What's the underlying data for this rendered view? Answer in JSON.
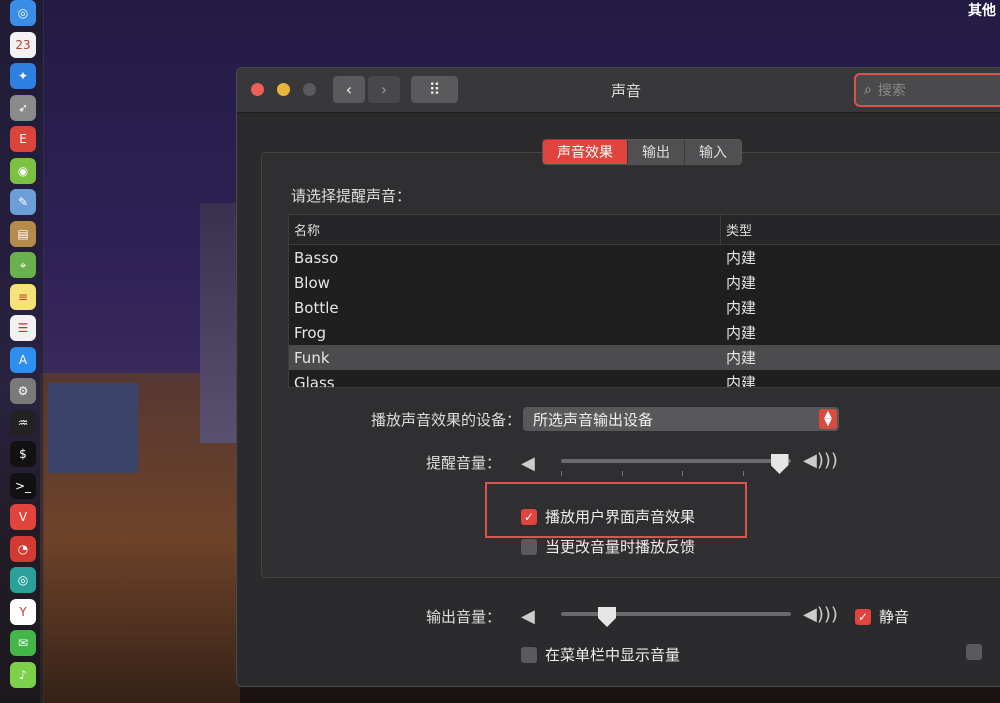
{
  "desktop": {
    "top_right_text": "其他"
  },
  "dock": {
    "items": [
      {
        "icon": "safari-icon",
        "color": "#3a8ee6",
        "glyph": "◎"
      },
      {
        "icon": "calendar-icon",
        "color": "#f2f2f2",
        "glyph": "23"
      },
      {
        "icon": "compass-icon",
        "color": "#2f7fe0",
        "glyph": "✦"
      },
      {
        "icon": "rocket-icon",
        "color": "#8a8a8a",
        "glyph": "➶"
      },
      {
        "icon": "app-red-icon",
        "color": "#d9453b",
        "glyph": "E"
      },
      {
        "icon": "android-icon",
        "color": "#7cc142",
        "glyph": "◉"
      },
      {
        "icon": "preview-icon",
        "color": "#6c9fd8",
        "glyph": "✎"
      },
      {
        "icon": "notebook-icon",
        "color": "#b58b4c",
        "glyph": "▤"
      },
      {
        "icon": "maps-icon",
        "color": "#6ab04c",
        "glyph": "⌖"
      },
      {
        "icon": "notes-icon",
        "color": "#f5e27a",
        "glyph": "≡"
      },
      {
        "icon": "reminders-icon",
        "color": "#f2f2f2",
        "glyph": "☰"
      },
      {
        "icon": "appstore-icon",
        "color": "#2f8ff0",
        "glyph": "A"
      },
      {
        "icon": "system-preferences-icon",
        "color": "#7a7a7a",
        "glyph": "⚙"
      },
      {
        "icon": "activity-monitor-icon",
        "color": "#222",
        "glyph": "♒"
      },
      {
        "icon": "terminal-dollar-icon",
        "color": "#111",
        "glyph": "$"
      },
      {
        "icon": "terminal-icon",
        "color": "#111",
        "glyph": ">_"
      },
      {
        "icon": "vivaldi-icon",
        "color": "#e0443c",
        "glyph": "V"
      },
      {
        "icon": "netease-music-icon",
        "color": "#d33a31",
        "glyph": "◔"
      },
      {
        "icon": "eye-app-icon",
        "color": "#2aa198",
        "glyph": "◎"
      },
      {
        "icon": "yandex-icon",
        "color": "#ffffff",
        "glyph": "Y"
      },
      {
        "icon": "wechat-icon",
        "color": "#44b549",
        "glyph": "✉"
      },
      {
        "icon": "note-app-icon",
        "color": "#7cd04a",
        "glyph": "♪"
      }
    ]
  },
  "window": {
    "title": "声音",
    "search_placeholder": "搜索",
    "back_glyph": "‹",
    "forward_glyph": "›",
    "grid_glyph": "⠿",
    "tabs": [
      "声音效果",
      "输出",
      "输入"
    ],
    "active_tab": 0,
    "prompt": "请选择提醒声音：",
    "list": {
      "headers": [
        "名称",
        "类型"
      ],
      "rows": [
        {
          "name": "Basso",
          "type": "内建"
        },
        {
          "name": "Blow",
          "type": "内建"
        },
        {
          "name": "Bottle",
          "type": "内建"
        },
        {
          "name": "Frog",
          "type": "内建"
        },
        {
          "name": "Funk",
          "type": "内建"
        },
        {
          "name": "Glass",
          "type": "内建"
        }
      ],
      "selected_index": 4
    },
    "device_label": "播放声音效果的设备：",
    "device_value": "所选声音输出设备",
    "alert_volume_label": "提醒音量：",
    "alert_volume_level": 0.95,
    "ui_sound_label": "播放用户界面声音效果",
    "ui_sound_checked": true,
    "feedback_label": "当更改音量时播放反馈",
    "feedback_checked": false,
    "output_volume_label": "输出音量：",
    "output_volume_level": 0.2,
    "mute_label": "静音",
    "mute_checked": true,
    "menubar_label": "在菜单栏中显示音量",
    "menubar_checked": false
  }
}
